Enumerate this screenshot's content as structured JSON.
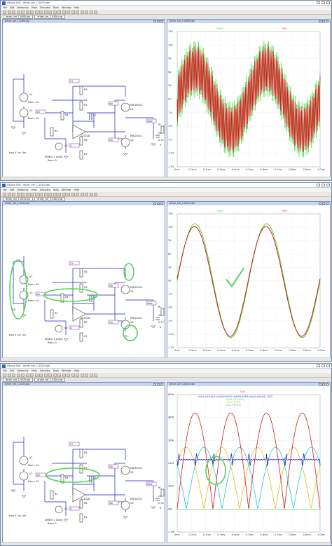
{
  "windows": [
    {
      "title": "LTspice XVII - driver_ver_1-0400.raw",
      "menu": [
        "File",
        "Edit",
        "Hierarchy",
        "View",
        "Simulate",
        "Tools",
        "Window",
        "Help"
      ],
      "tabs": [
        "driver_ver_1-0400.asc",
        "driver_ver_1-0400.raw"
      ],
      "schematic_title": "driver_ver_1-0400.asc",
      "plot_title": "driver_ver_1-0400.raw",
      "trace_label": "V(out)",
      "trace_label2": "V(r)"
    },
    {
      "title": "LTspice XVII - driver_ver_1-0410.raw",
      "menu": [
        "File",
        "Edit",
        "Hierarchy",
        "View",
        "Simulate",
        "Tools",
        "Window",
        "Help"
      ],
      "tabs": [
        "driver_ver_1-0410.asc",
        "driver_ver_1-0410.raw"
      ],
      "schematic_title": "driver_ver_1-0410.asc",
      "plot_title": "driver_ver_1-0410.raw",
      "trace_label": "V(out)",
      "trace_label2": "V(r)"
    },
    {
      "title": "LTspice XVII - driver_ver_1-0420.raw",
      "menu": [
        "File",
        "Edit",
        "Hierarchy",
        "View",
        "Simulate",
        "Tools",
        "Window",
        "Help"
      ],
      "tabs": [
        "driver_ver_1-0420.asc",
        "driver_ver_1-0420.raw"
      ],
      "schematic_title": "driver_ver_1-0420.asc",
      "plot_title": "driver_ver_1-0420.raw",
      "trace_label": "V(r)",
      "trace_legend": [
        "V(V1:n1)*I(V1)+V(V2)*I(V2)+V(R1)*I(R1)+I(Q1)*V(Q1) OUT",
        "V(V1:n1)*I(V1)",
        "V(V2)*I(V2)",
        "I(Q1)*V(Q1)"
      ]
    }
  ],
  "schematic": {
    "components": {
      "v1": "V1",
      "v2": "V2",
      "r1": "R1",
      "r2": "R2",
      "r3": "R3",
      "r4": "R4",
      "r5": "R5",
      "r6": "R6",
      "c1": "C1",
      "c2": "C2",
      "u1": "LT1028",
      "q1": "Q1",
      "q2": "Q2",
      "q1model": "MJE15030",
      "q2model": "MJE15031",
      "v3": "V3",
      "vcc": "V+",
      "vee": "V-",
      "vin": "Vin",
      "vout": "Vout",
      "rload": "RL",
      "rload_val": "4",
      "c_val": "0.7u",
      "v1val": "Rser=.01",
      "v2val": "Rser=.01",
      "r4val": "10k",
      "r6val": "10k",
      "sine": "SINE(0 1 1000)",
      "sine_rser": "Rser=0",
      "directive": ".tran 0 1m .5m"
    }
  },
  "plots": {
    "x_ticks": [
      "0ms",
      "0.1ms",
      "0.2ms",
      "0.3ms",
      "0.4ms",
      "0.5ms",
      "0.6ms",
      "0.7ms",
      "0.8ms",
      "0.9ms",
      "1.0ms"
    ],
    "y_ticks_v": [
      "15V",
      "12V",
      "9V",
      "6V",
      "3V",
      "0V",
      "-3V",
      "-6V",
      "-9V",
      "-12V",
      "-15V"
    ],
    "y_ticks_p": [
      "60W",
      "48W",
      "36W",
      "24W",
      "12W",
      "0W",
      "-12W"
    ]
  },
  "colors": {
    "red": "#d11a1a",
    "green": "#3fe03f",
    "blue": "#2a2ad8",
    "cyan": "#27c7d8",
    "yellow": "#d8c41c",
    "highlight": "#52d452",
    "plotbg": "#ffffff",
    "grid": "#cfcfcf"
  }
}
